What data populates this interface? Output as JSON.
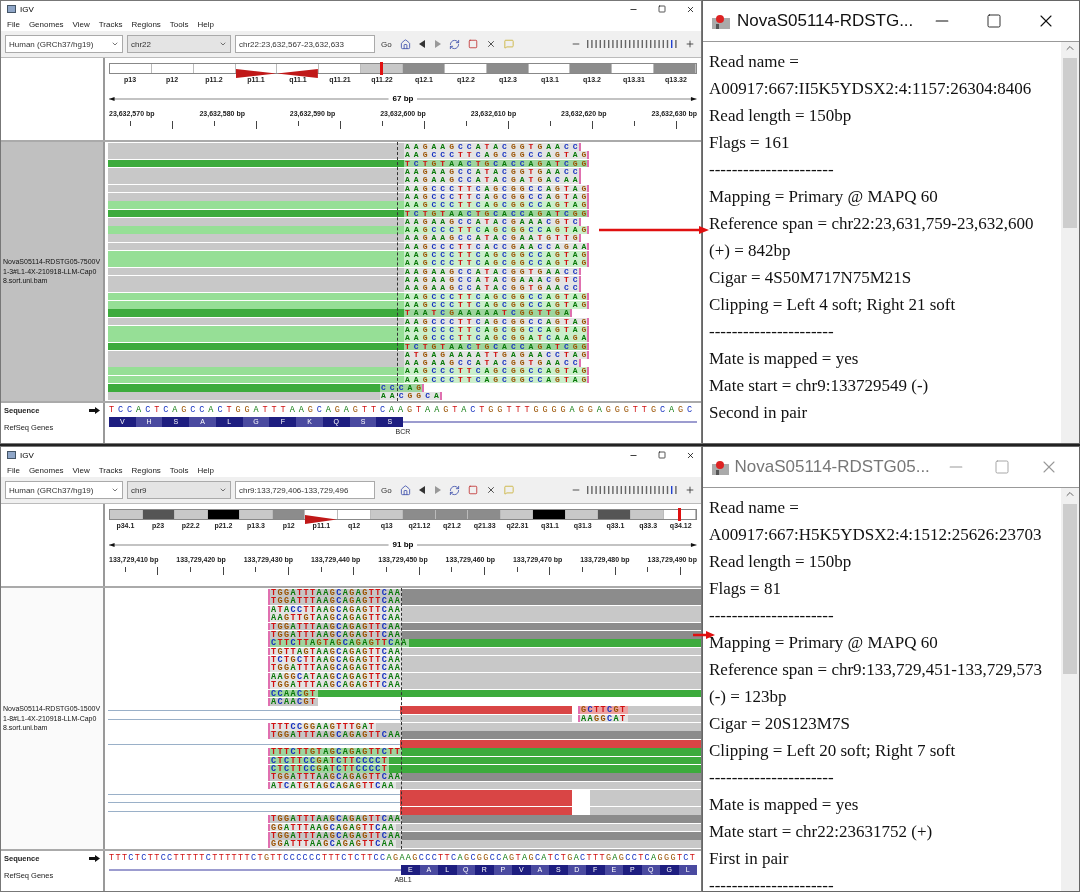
{
  "panels": [
    {
      "igv": {
        "title": "IGV",
        "menu": [
          "File",
          "Genomes",
          "View",
          "Tracks",
          "Regions",
          "Tools",
          "Help"
        ],
        "genome": "Human (GRCh37/hg19)",
        "chromosome": "chr22",
        "locus": "chr22:23,632,567-23,632,633",
        "go": "Go",
        "cytobands": [
          {
            "label": "p13",
            "kind": "gneg",
            "selected": false
          },
          {
            "label": "p12",
            "kind": "gneg",
            "selected": false
          },
          {
            "label": "p11.2",
            "kind": "gneg",
            "selected": false
          },
          {
            "label": "p11.1",
            "kind": "acen_p",
            "selected": false
          },
          {
            "label": "q11.1",
            "kind": "acen_q",
            "selected": false
          },
          {
            "label": "q11.21",
            "kind": "gneg",
            "selected": false
          },
          {
            "label": "q11.22",
            "kind": "gpos25",
            "selected": true
          },
          {
            "label": "q12.1",
            "kind": "gpos50",
            "selected": false
          },
          {
            "label": "q12.2",
            "kind": "gneg",
            "selected": false
          },
          {
            "label": "q12.3",
            "kind": "gpos50",
            "selected": false
          },
          {
            "label": "q13.1",
            "kind": "gneg",
            "selected": false
          },
          {
            "label": "q13.2",
            "kind": "gpos50",
            "selected": false
          },
          {
            "label": "q13.31",
            "kind": "gneg",
            "selected": false
          },
          {
            "label": "q13.32",
            "kind": "gpos50",
            "selected": false
          }
        ],
        "span": "67 bp",
        "ruler": [
          "23,632,570 bp",
          "23,632,580 bp",
          "23,632,590 bp",
          "23,632,600 bp",
          "23,632,610 bp",
          "23,632,620 bp",
          "23,632,630 bp"
        ],
        "sample": {
          "name": "NovaS05114-RDSTG05-7500V1-3#L1-4X-210918-LLM-Cap08.sort.uni.bam",
          "selected": true
        },
        "reads": [
          {
            "kind": "tail",
            "color": "#c8c8c8",
            "bases": "A A G A A G C C A T A C G G T G A A C C"
          },
          {
            "kind": "tail",
            "color": "#c8c8c8",
            "bases": "A A G C C C T T C A G C G G C C A G T A G"
          },
          {
            "kind": "tail",
            "color": "#3cab3c",
            "bases": "T C T G T A A C T G C A C C A G A T C G G"
          },
          {
            "kind": "tail",
            "color": "#c8c8c8",
            "bases": "A A G A A G C C A T A C G G T G A A C C"
          },
          {
            "kind": "tail",
            "color": "#c8c8c8",
            "bases": "A A G A A G C C A T A C G A T G A C A A"
          },
          {
            "kind": "tail",
            "color": "#c8c8c8",
            "bases": "A A G C C C T T C A G C G G C C A G T A G"
          },
          {
            "kind": "tail",
            "color": "#c8c8c8",
            "bases": "A A G C C C T T C A G C G G C C A G T A G"
          },
          {
            "kind": "tail",
            "color": "#96df96",
            "bases": "A A G C C C T T C A G C G G C C A G T A G"
          },
          {
            "kind": "tail",
            "color": "#3cab3c",
            "bases": "T C T G T A A C T G C A C C A G A T C G G"
          },
          {
            "kind": "tail",
            "color": "#c8c8c8",
            "bases": "A A G A A G C C A T A C G A A A C G T C"
          },
          {
            "kind": "tail",
            "color": "#96df96",
            "bases": "A A G C C C T T C A G C G G C C A G T A G",
            "pointed": true
          },
          {
            "kind": "tail",
            "color": "#c8c8c8",
            "bases": "A A G A A G C C A T A C G A A T G T T G"
          },
          {
            "kind": "tail",
            "color": "#c8c8c8",
            "bases": "A A G C C C T T C A C C G A A C C A G A A"
          },
          {
            "kind": "tail",
            "color": "#96df96",
            "bases": "A A G C C C T T C A G C G G C C A G T A G"
          },
          {
            "kind": "tail",
            "color": "#96df96",
            "bases": "A A G C C C T T C A G C G G C C A G T A G"
          },
          {
            "kind": "tail",
            "color": "#c8c8c8",
            "bases": "A A G A A G C C A T A C G G T G A A C C"
          },
          {
            "kind": "tail",
            "color": "#c8c8c8",
            "bases": "A A G A A G C C A T A C G A A A C G T C"
          },
          {
            "kind": "tail",
            "color": "#c8c8c8",
            "bases": "A A G A A G C C A T A C G G T G A A C C"
          },
          {
            "kind": "tail",
            "color": "#96df96",
            "bases": "A A G C C C T T C A G C G G C C A G T A G"
          },
          {
            "kind": "tail",
            "color": "#96df96",
            "bases": "A A G C C C T T C A G C G G C C A G T A G"
          },
          {
            "kind": "tail",
            "color": "#3cab3c",
            "bases": "T A A T C G A A A A A T C G G T T G A"
          },
          {
            "kind": "tail",
            "color": "#c8c8c8",
            "bases": "A A G C C C T T C A G C G G C C A G T A G"
          },
          {
            "kind": "tail",
            "color": "#96df96",
            "bases": "A A G C C C T T C A G C G G C C A G T A G"
          },
          {
            "kind": "tail",
            "color": "#96df96",
            "bases": "A A G C C C T T C A G C G G A T C A A G A"
          },
          {
            "kind": "tail",
            "color": "#3cab3c",
            "bases": "T C T G T A A C T G C A C C A G A T C G G"
          },
          {
            "kind": "tail",
            "color": "#c8c8c8",
            "bases": "A T G A G A A A A T T G A G A A C C T A G"
          },
          {
            "kind": "tail",
            "color": "#c8c8c8",
            "bases": "A A G A A G C C A T A C G G T G A A C C"
          },
          {
            "kind": "tail",
            "color": "#96df96",
            "bases": "A A G C C C T T C A G C G G C C A G T A G"
          },
          {
            "kind": "tail",
            "color": "#96df96",
            "bases": "A A G C C C T T C A G C G G C C A G T A G"
          },
          {
            "kind": "short",
            "color": "#3cab3c",
            "bases": "C C C A G"
          },
          {
            "kind": "short",
            "color": "#c8c8c8",
            "bases": "A A C G G C A"
          }
        ],
        "sequence_label": "Sequence",
        "sequence": "T C C A C T C A G C C A C T G G A T T T A A G C A G A G T T C A A G T A A G T A C T G G T T T G G G G A G G A G G G T T G C A G C",
        "genes_label": "RefSeq Genes",
        "exon_first": true,
        "amino_acids": [
          "V",
          "H",
          "S",
          "A",
          "L",
          "G",
          "F",
          "K",
          "Q",
          "S",
          "S"
        ],
        "gene": "BCR"
      },
      "popup": {
        "title": "NovaS05114-RDSTG...",
        "active": true,
        "lines": [
          "Read name =",
          "A00917:667:II5K5YDSX2:4:1157:26304:8406",
          "Read length = 150bp",
          "Flags = 161",
          "----------------------",
          "Mapping = Primary @ MAPQ 60",
          "Reference span = chr22:23,631,759-23,632,600",
          "(+) = 842bp",
          "Cigar = 4S50M717N75M21S",
          "Clipping = Left 4 soft; Right 21 soft",
          "----------------------",
          "Mate is mapped = yes",
          "Mate start = chr9:133729549 (-)",
          "Second in pair"
        ]
      }
    },
    {
      "igv": {
        "title": "IGV",
        "menu": [
          "File",
          "Genomes",
          "View",
          "Tracks",
          "Regions",
          "Tools",
          "Help"
        ],
        "genome": "Human (GRCh37/hg19)",
        "chromosome": "chr9",
        "locus": "chr9:133,729,406-133,729,496",
        "go": "Go",
        "cytobands": [
          {
            "label": "p34.1",
            "kind": "gpos25",
            "selected": false
          },
          {
            "label": "p23",
            "kind": "gpos75",
            "selected": false
          },
          {
            "label": "p22.2",
            "kind": "gpos25",
            "selected": false
          },
          {
            "label": "p21.2",
            "kind": "gpos100",
            "selected": false
          },
          {
            "label": "p13.3",
            "kind": "gpos25",
            "selected": false
          },
          {
            "label": "p12",
            "kind": "gpos50",
            "selected": false
          },
          {
            "label": "p11.1",
            "kind": "acen_p",
            "selected": false
          },
          {
            "label": "q12",
            "kind": "gneg",
            "selected": false
          },
          {
            "label": "q13",
            "kind": "gpos25",
            "selected": false
          },
          {
            "label": "q21.12",
            "kind": "gpos50",
            "selected": false
          },
          {
            "label": "q21.2",
            "kind": "gpos50",
            "selected": false
          },
          {
            "label": "q21.33",
            "kind": "gpos50",
            "selected": false
          },
          {
            "label": "q22.31",
            "kind": "gpos25",
            "selected": false
          },
          {
            "label": "q31.1",
            "kind": "gpos100",
            "selected": false
          },
          {
            "label": "q31.3",
            "kind": "gpos25",
            "selected": false
          },
          {
            "label": "q33.1",
            "kind": "gpos75",
            "selected": false
          },
          {
            "label": "q33.3",
            "kind": "gpos25",
            "selected": false
          },
          {
            "label": "q34.12",
            "kind": "gneg",
            "selected": true
          }
        ],
        "span": "91 bp",
        "ruler": [
          "133,729,410 bp",
          "133,729,420 bp",
          "133,729,430 bp",
          "133,729,440 bp",
          "133,729,450 bp",
          "133,729,460 bp",
          "133,729,470 bp",
          "133,729,480 bp",
          "133,729,490 bp"
        ],
        "sample": {
          "name": "NovaS05114-RDSTG05-1500V1-8#L1-4X-210918-LLM-Cap08.sort.uni.bam",
          "selected": false
        },
        "reads": [
          {
            "kind": "clip",
            "color": "#8c8c8c",
            "bases": "TGGATTTAAGCAGAGTTCAA"
          },
          {
            "kind": "clip",
            "color": "#8c8c8c",
            "bases": "TGGATTTAAGCAGAGTTCAA"
          },
          {
            "kind": "clip",
            "color": "#c8c8c8",
            "bases": "ATACCTTAAGCAGAGTTCAA"
          },
          {
            "kind": "clip",
            "color": "#c8c8c8",
            "bases": "AAGTTGTAAGCAGAGTTCAA"
          },
          {
            "kind": "clip",
            "color": "#8c8c8c",
            "bases": "TGGATTTAAGCAGAGTTCAA"
          },
          {
            "kind": "clip",
            "color": "#8c8c8c",
            "bases": "TGGATTTAAGCAGAGTTCAA",
            "pointed": true
          },
          {
            "kind": "clip",
            "color": "#3cab3c",
            "bases": "CTTCTTAGTAGCAGAGTTCAA"
          },
          {
            "kind": "clip",
            "color": "#c8c8c8",
            "bases": "TGTTAGTAAGCAGAGTTCAA"
          },
          {
            "kind": "clip",
            "color": "#c8c8c8",
            "bases": "TCTGCTTAAGCAGAGTTCAA"
          },
          {
            "kind": "clip",
            "color": "#c8c8c8",
            "bases": "TGGATTTAAGCAGAGTTCAA"
          },
          {
            "kind": "clip",
            "color": "#c8c8c8",
            "bases": "AAGGCATAAGCAGAGTTCAA"
          },
          {
            "kind": "clip",
            "color": "#c8c8c8",
            "bases": "TGGATTTAAGCAGAGTTCAA"
          },
          {
            "kind": "clip",
            "color": "#3cab3c",
            "bases": "CCAACGT"
          },
          {
            "kind": "clip_end",
            "color": "#c8c8c8",
            "bases": "ACAACGT"
          },
          {
            "kind": "split",
            "color": "#d94545",
            "bases": "GCTTCGT"
          },
          {
            "kind": "split",
            "color": "#c8c8c8",
            "bases": "AAGGCAT"
          },
          {
            "kind": "clip",
            "color": "#c8c8c8",
            "bases": "TTTCCGGAAGTTTGAT"
          },
          {
            "kind": "clip",
            "color": "#8c8c8c",
            "bases": "TGGATTTAAGCAGAGTTCAA"
          },
          {
            "kind": "linked",
            "color": "#d94545"
          },
          {
            "kind": "clip",
            "color": "#3cab3c",
            "bases": "TTTCTTGTAGCAGAGTTCTT"
          },
          {
            "kind": "clip",
            "color": "#3cab3c",
            "bases": "CTCTTCCGATCTTCCCCT"
          },
          {
            "kind": "clip",
            "color": "#3cab3c",
            "bases": "CTCTTCCGATCTTCCCCT"
          },
          {
            "kind": "clip",
            "color": "#8c8c8c",
            "bases": "TGGATTTAAGCAGAGTTCAA"
          },
          {
            "kind": "clip",
            "color": "#c8c8c8",
            "bases": "ATCATGTAGCAGAGTTCAA"
          },
          {
            "kind": "split",
            "color": "#d94545"
          },
          {
            "kind": "split",
            "color": "#d94545"
          },
          {
            "kind": "split",
            "color": "#d94545"
          },
          {
            "kind": "clip",
            "color": "#8c8c8c",
            "bases": "TGGATTTAAGCAGAGTTCAA"
          },
          {
            "kind": "clip",
            "color": "#c8c8c8",
            "bases": "GGATTTAAGCAGAGTTCAA"
          },
          {
            "kind": "clip",
            "color": "#8c8c8c",
            "bases": "TGGATTTAAGCAGAGTTCAA"
          },
          {
            "kind": "clip",
            "color": "#c8c8c8",
            "bases": "GGATTTAAGCAGAGTTCAA"
          }
        ],
        "sequence_label": "Sequence",
        "sequence": "TTTCTCTTCCTTTTTCTTTTTTCTGTTCCCCCCTTTCTCTTCCAGAAGCCCTTCAGCGGCCAGTAGCATCTGACTTTGAGCCTCAGGGTCT",
        "genes_label": "RefSeq Genes",
        "exon_first": false,
        "amino_acids": [
          "E",
          "A",
          "L",
          "Q",
          "R",
          "P",
          "V",
          "A",
          "S",
          "D",
          "F",
          "E",
          "P",
          "Q",
          "G",
          "L"
        ],
        "gene": "ABL1"
      },
      "popup": {
        "title": "NovaS05114-RDSTG05...",
        "active": false,
        "lines": [
          "Read name =",
          "A00917:667:H5K5YDSX2:4:1512:25626:23703",
          "Read length = 150bp",
          "Flags = 81",
          "----------------------",
          "Mapping = Primary @ MAPQ 60",
          "Reference span = chr9:133,729,451-133,729,573",
          "(-) = 123bp",
          "Cigar = 20S123M7S",
          "Clipping = Left 20 soft; Right 7 soft",
          "----------------------",
          "Mate is mapped = yes",
          "Mate start = chr22:23631752 (+)",
          "First in pair",
          "----------------------"
        ]
      }
    }
  ]
}
